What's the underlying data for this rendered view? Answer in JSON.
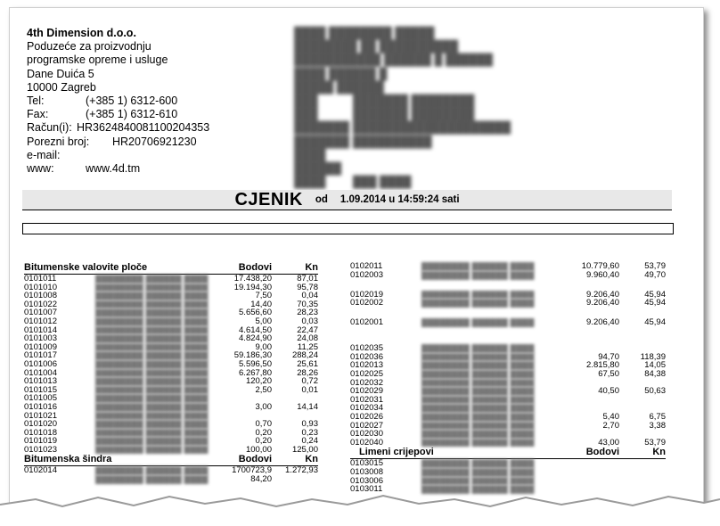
{
  "company": {
    "name": "4th Dimension d.o.o.",
    "line1": "Poduzeće za proizvodnju",
    "line2": "programske opreme i usluge",
    "street": "Dane Duića 5",
    "city": "10000 Zagreb",
    "tel_label": "Tel:",
    "tel": "(+385 1) 6312-600",
    "fax_label": "Fax:",
    "fax": "(+385 1) 6312-610",
    "account_label": "Račun(i):",
    "account": "HR3624840081100204353",
    "tax_label": "Porezni broj:",
    "tax": "HR20706921230",
    "email_label": "e-mail:",
    "email": "",
    "www_label": "www:",
    "www": "www.4d.tm"
  },
  "title": {
    "main": "CJENIK",
    "from": "od",
    "date": "1.09.2014 u 14:59:24 sati"
  },
  "left_section": {
    "header": {
      "name": "Bitumenske valovite ploče",
      "col3": "Bodovi",
      "col4": "Kn"
    },
    "rows": [
      {
        "code": "0101011",
        "bod": "17.438,20",
        "kn": "87,01"
      },
      {
        "code": "0101010",
        "bod": "19.194,30",
        "kn": "95,78"
      },
      {
        "code": "0101008",
        "bod": "7,50",
        "kn": "0,04"
      },
      {
        "code": "0101022",
        "bod": "14,40",
        "kn": "70,35"
      },
      {
        "code": "0101007",
        "bod": "5.656,60",
        "kn": "28,23"
      },
      {
        "code": "0101012",
        "bod": "5,00",
        "kn": "0,03"
      },
      {
        "code": "0101014",
        "bod": "4.614,50",
        "kn": "22,47"
      },
      {
        "code": "0101003",
        "bod": "4.824,90",
        "kn": "24,08"
      },
      {
        "code": "0101009",
        "bod": "9,00",
        "kn": "11,25"
      },
      {
        "code": "0101017",
        "bod": "59.186,30",
        "kn": "288,24"
      },
      {
        "code": "0101006",
        "bod": "5.596,50",
        "kn": "25,61"
      },
      {
        "code": "0101004",
        "bod": "6.267,80",
        "kn": "28,26"
      },
      {
        "code": "0101013",
        "bod": "120,20",
        "kn": "0,72"
      },
      {
        "code": "0101015",
        "bod": "2,50",
        "kn": "0,01"
      },
      {
        "code": "0101005",
        "bod": "",
        "kn": ""
      },
      {
        "code": "0101016",
        "bod": "3,00",
        "kn": "14,14"
      },
      {
        "code": "0101021",
        "bod": "",
        "kn": ""
      },
      {
        "code": "0101020",
        "bod": "0,70",
        "kn": "0,93"
      },
      {
        "code": "0101018",
        "bod": "0,20",
        "kn": "0,23"
      },
      {
        "code": "0101019",
        "bod": "0,20",
        "kn": "0,24"
      },
      {
        "code": "0101023",
        "bod": "100,00",
        "kn": "125,00"
      }
    ],
    "header2": {
      "name": "Bitumenska šindra",
      "col3": "Bodovi",
      "col4": "Kn"
    },
    "rows2": [
      {
        "code": "0102014",
        "bod": "1700723,9",
        "kn": "1.272,93"
      },
      {
        "code": "",
        "bod": "84,20",
        "kn": ""
      }
    ]
  },
  "right_section": {
    "rows": [
      {
        "code": "0102011",
        "bod": "10.779,60",
        "kn": "53,79",
        "h": "n"
      },
      {
        "code": "0102003",
        "bod": "9.960,40",
        "kn": "49,70",
        "h": "t"
      },
      {
        "code": "0102019",
        "bod": "9.206,40",
        "kn": "45,94",
        "h": "n"
      },
      {
        "code": "0102002",
        "bod": "9.206,40",
        "kn": "45,94",
        "h": "t"
      },
      {
        "code": "0102001",
        "bod": "9.206,40",
        "kn": "45,94",
        "h": "t3"
      },
      {
        "code": "0102035",
        "bod": "",
        "kn": "",
        "h": "n"
      },
      {
        "code": "0102036",
        "bod": "94,70",
        "kn": "118,39",
        "h": "n"
      },
      {
        "code": "0102013",
        "bod": "2.815,80",
        "kn": "14,05",
        "h": "n"
      },
      {
        "code": "0102025",
        "bod": "67,50",
        "kn": "84,38",
        "h": "n"
      },
      {
        "code": "0102032",
        "bod": "",
        "kn": "",
        "h": "n"
      },
      {
        "code": "0102029",
        "bod": "40,50",
        "kn": "50,63",
        "h": "n"
      },
      {
        "code": "0102031",
        "bod": "",
        "kn": "",
        "h": "n"
      },
      {
        "code": "0102034",
        "bod": "",
        "kn": "",
        "h": "n"
      },
      {
        "code": "0102026",
        "bod": "5,40",
        "kn": "6,75",
        "h": "n"
      },
      {
        "code": "0102027",
        "bod": "2,70",
        "kn": "3,38",
        "h": "n"
      },
      {
        "code": "0102030",
        "bod": "",
        "kn": "",
        "h": "n"
      },
      {
        "code": "0102040",
        "bod": "43,00",
        "kn": "53,79",
        "h": "n"
      }
    ],
    "header2": {
      "name": "Limeni crijepovi",
      "col3": "Bodovi",
      "col4": "Kn"
    },
    "rows2": [
      {
        "code": "0103015",
        "bod": "",
        "kn": ""
      },
      {
        "code": "0103008",
        "bod": "",
        "kn": ""
      },
      {
        "code": "0103006",
        "bod": "",
        "kn": ""
      },
      {
        "code": "0103011",
        "bod": "",
        "kn": ""
      }
    ]
  }
}
